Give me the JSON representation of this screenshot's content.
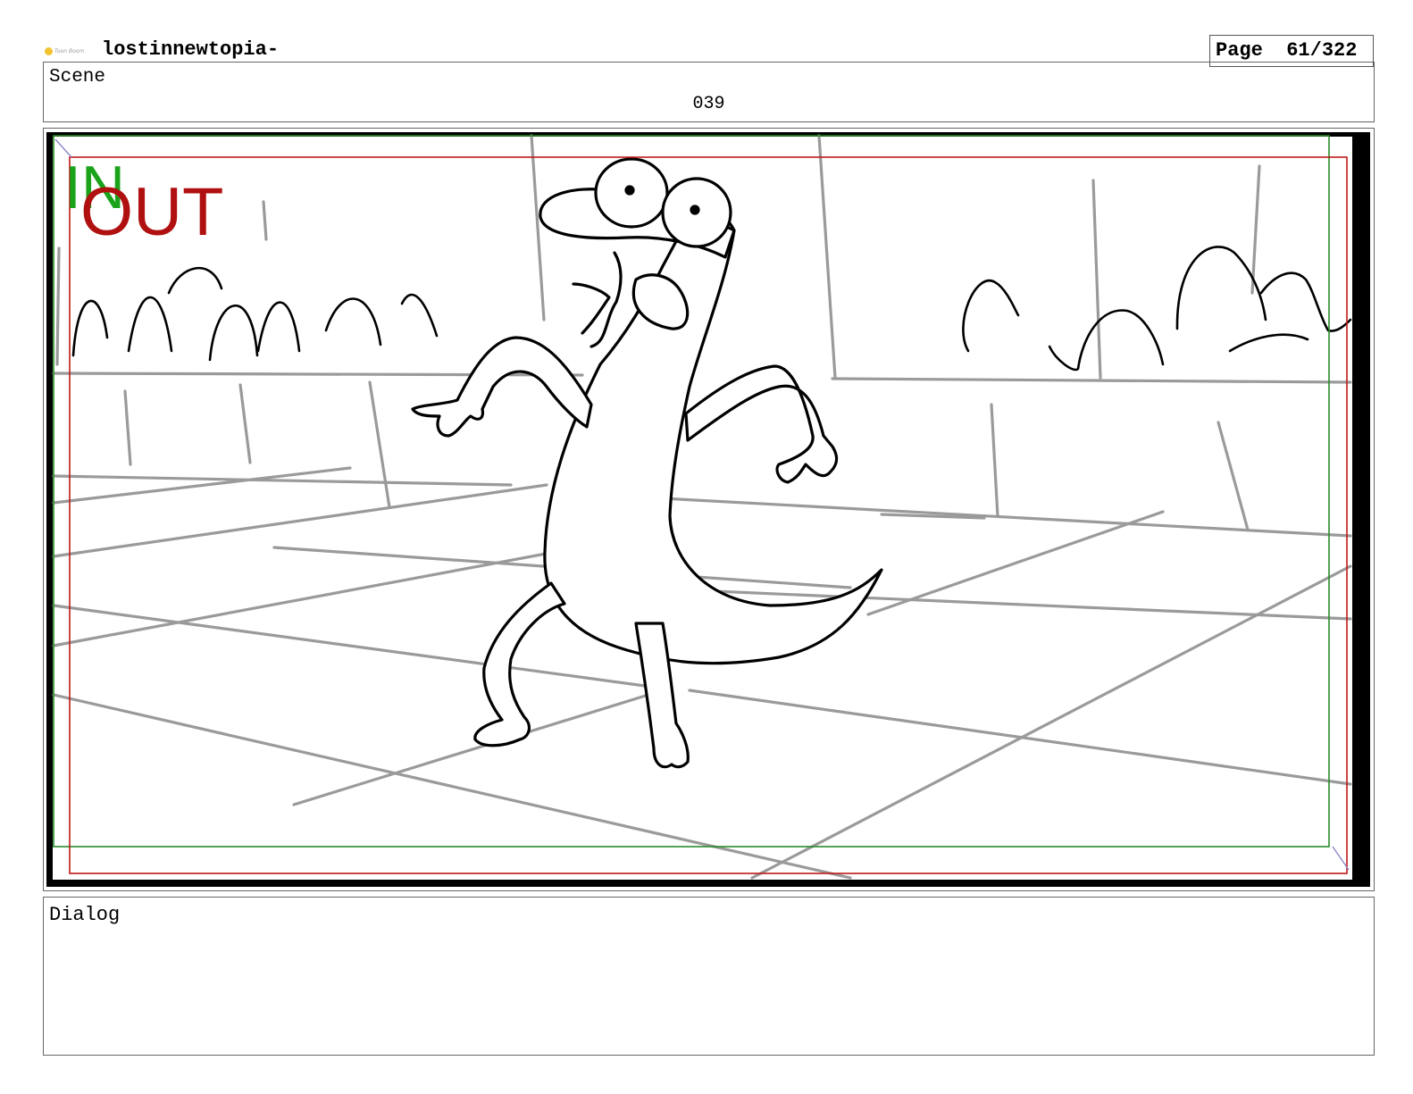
{
  "header": {
    "logo_text": "Toon Boom",
    "project_title": "lostinnewtopia-",
    "page_label": "Page",
    "page_value": "61/322"
  },
  "scene": {
    "label": "Scene",
    "number": "039"
  },
  "panel": {
    "in_marker": "IN",
    "out_marker": "OUT",
    "colors": {
      "in_marker": "#1aa31a",
      "out_marker": "#b01010",
      "safe_frame_green": "#2a8a2a",
      "safe_frame_red": "#c01818",
      "background_lines": "#9a9a9a",
      "character_lines": "#000000"
    }
  },
  "dialog": {
    "label": "Dialog"
  }
}
